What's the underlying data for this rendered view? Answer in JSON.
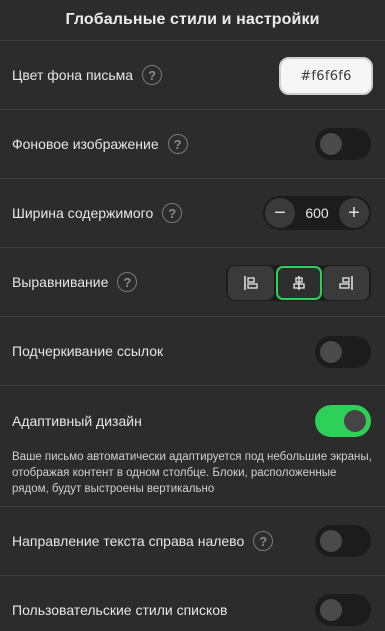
{
  "header": {
    "title": "Глобальные стили и настройки"
  },
  "settings": {
    "bg_color": {
      "label": "Цвет фона письма",
      "value": "#f6f6f6",
      "help": "?"
    },
    "bg_image": {
      "label": "Фоновое изображение",
      "help": "?",
      "enabled": false
    },
    "content_width": {
      "label": "Ширина содержимого",
      "help": "?",
      "value": "600",
      "minus": "−",
      "plus": "+"
    },
    "alignment": {
      "label": "Выравнивание",
      "help": "?",
      "options": [
        "left",
        "center",
        "right"
      ],
      "selected": "center"
    },
    "link_underline": {
      "label": "Подчеркивание ссылок",
      "enabled": false
    },
    "responsive": {
      "label": "Адаптивный дизайн",
      "enabled": true,
      "description": "Ваше письмо автоматически адаптируется под небольшие экраны, отображая контент в одном столбце. Блоки, расположенные рядом, будут выстроены вертикально"
    },
    "rtl": {
      "label": "Направление текста справа налево",
      "help": "?",
      "enabled": false
    },
    "list_styles": {
      "label": "Пользовательские стили списков",
      "enabled": false
    }
  },
  "colors": {
    "accent": "#2ed158",
    "background": "#2c2c2c",
    "control_bg": "#1c1c1c"
  }
}
